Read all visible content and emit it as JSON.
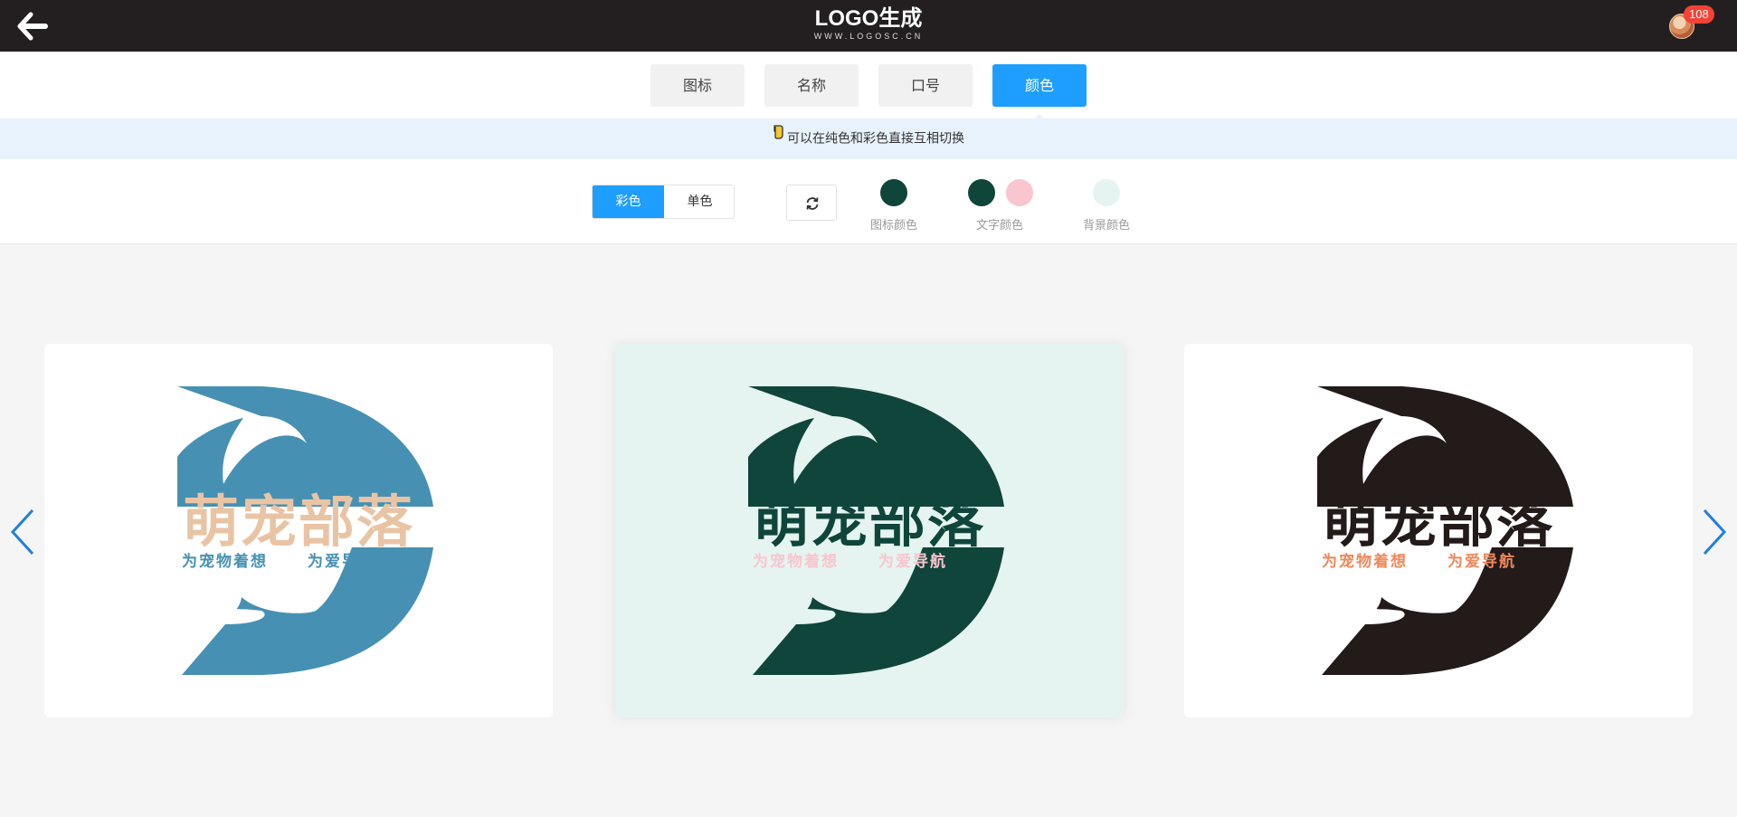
{
  "header": {
    "brand_main": "LOGO生成",
    "brand_sub": "WWW.LOGOSC.CN",
    "notification_count": "108"
  },
  "tabs": [
    {
      "label": "图标",
      "active": false
    },
    {
      "label": "名称",
      "active": false
    },
    {
      "label": "口号",
      "active": false
    },
    {
      "label": "颜色",
      "active": true
    }
  ],
  "tip": {
    "text": "可以在纯色和彩色直接互相切换"
  },
  "color_mode": {
    "options": [
      {
        "label": "彩色",
        "active": true
      },
      {
        "label": "单色",
        "active": false
      }
    ]
  },
  "swatches": {
    "icon_color": {
      "label": "图标颜色",
      "color": "#0f453a"
    },
    "text_color": {
      "label": "文字颜色",
      "colors": [
        "#0f453a",
        "#f9c5cf"
      ]
    },
    "bg_color": {
      "label": "背景颜色",
      "color": "#e5f4f0"
    }
  },
  "logo": {
    "name": "萌宠部落",
    "slogan_left": "为宠物着想",
    "slogan_right": "为爱导航"
  },
  "cards": [
    {
      "bg": "#ffffff",
      "icon_color": "#4691b3",
      "name_color": "#e9c4a4",
      "slogan_color": "#4691b3"
    },
    {
      "bg": "#e5f4f0",
      "icon_color": "#0f453a",
      "name_color": "#0f453a",
      "slogan_color": "#f9c5cf"
    },
    {
      "bg": "#ffffff",
      "icon_color": "#231a1a",
      "name_color": "#231a1a",
      "slogan_color": "#f0885a"
    }
  ],
  "colors": {
    "accent": "#1e9fff",
    "topbar": "#231f20",
    "tip_bg": "#e7f2fc"
  }
}
